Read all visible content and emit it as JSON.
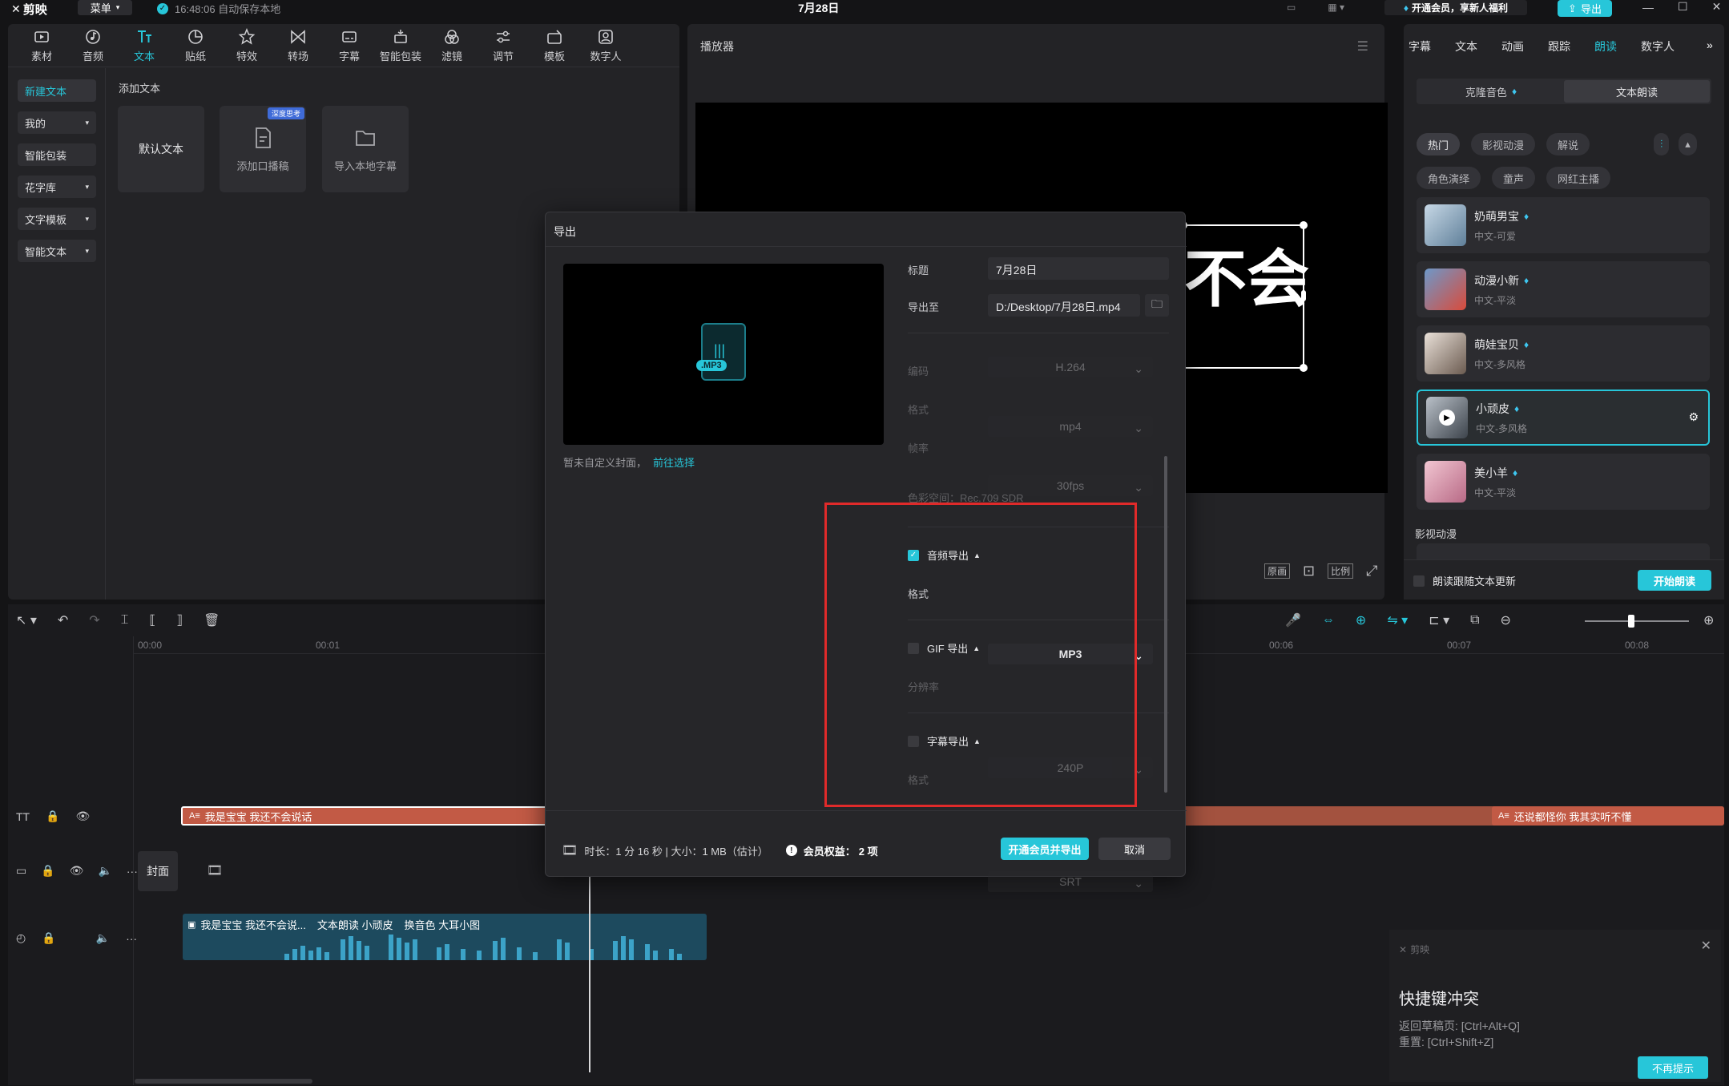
{
  "app": {
    "logo": "剪映",
    "menu_label": "菜单",
    "save_status": "16:48:06 自动保存本地",
    "project_title": "7月28日",
    "vip_promo": "开通会员，享新人福利",
    "export_label": "导出"
  },
  "toolbar": {
    "items": [
      {
        "label": "素材"
      },
      {
        "label": "音频"
      },
      {
        "label": "文本"
      },
      {
        "label": "贴纸"
      },
      {
        "label": "特效"
      },
      {
        "label": "转场"
      },
      {
        "label": "字幕"
      },
      {
        "label": "智能包装"
      },
      {
        "label": "滤镜"
      },
      {
        "label": "调节"
      },
      {
        "label": "模板"
      },
      {
        "label": "数字人"
      }
    ]
  },
  "sidebar": {
    "items": [
      {
        "label": "新建文本"
      },
      {
        "label": "我的"
      },
      {
        "label": "智能包装"
      },
      {
        "label": "花字库"
      },
      {
        "label": "文字模板"
      },
      {
        "label": "智能文本"
      }
    ]
  },
  "text_panel": {
    "heading": "添加文本",
    "cards": [
      {
        "label": "默认文本"
      },
      {
        "label": "添加口播稿",
        "badge": "深度思考"
      },
      {
        "label": "导入本地字幕"
      }
    ]
  },
  "player": {
    "title": "播放器",
    "preview_text": "不会",
    "controls": [
      "原画",
      "比例"
    ]
  },
  "right_panel": {
    "tabs": [
      {
        "label": "字幕"
      },
      {
        "label": "文本"
      },
      {
        "label": "动画"
      },
      {
        "label": "跟踪"
      },
      {
        "label": "朗读"
      },
      {
        "label": "数字人"
      }
    ],
    "sub_tabs": [
      {
        "label": "克隆音色"
      },
      {
        "label": "文本朗读"
      }
    ],
    "filters": [
      {
        "label": "热门"
      },
      {
        "label": "影视动漫"
      },
      {
        "label": "解说"
      },
      {
        "label": "角色演绎"
      },
      {
        "label": "童声"
      },
      {
        "label": "网红主播"
      }
    ],
    "voices": [
      {
        "name": "奶萌男宝",
        "desc": "中文-可爱"
      },
      {
        "name": "动漫小新",
        "desc": "中文-平淡"
      },
      {
        "name": "萌娃宝贝",
        "desc": "中文-多风格"
      },
      {
        "name": "小顽皮",
        "desc": "中文-多风格"
      },
      {
        "name": "美小羊",
        "desc": "中文-平淡"
      }
    ],
    "section_label": "影视动漫",
    "follow_label": "朗读跟随文本更新",
    "start_button": "开始朗读"
  },
  "export_dialog": {
    "title": "导出",
    "cover_note": "暂未自定义封面，",
    "cover_link": "前往选择",
    "file_badge": ".MP3",
    "title_label": "标题",
    "title_value": "7月28日",
    "path_label": "导出至",
    "path_value": "D:/Desktop/7月28日.mp4",
    "codec_label": "编码",
    "codec_value": "H.264",
    "format_label": "格式",
    "format_value": "mp4",
    "fps_label": "帧率",
    "fps_value": "30fps",
    "colorspace_text": "色彩空间：Rec.709 SDR",
    "audio_export_label": "音频导出",
    "audio_format_label": "格式",
    "audio_format_value": "MP3",
    "gif_export_label": "GIF 导出",
    "gif_res_label": "分辨率",
    "gif_res_value": "240P",
    "subtitle_export_label": "字幕导出",
    "subtitle_format_label": "格式",
    "subtitle_format_value": "SRT",
    "footer_info": "时长：1 分 16 秒 | 大小：1 MB（估计）",
    "member_label": "会员权益：",
    "member_count": "2 项",
    "vip_export_button": "开通会员并导出",
    "cancel_button": "取消"
  },
  "timeline": {
    "ticks": [
      "00:00",
      "00:01",
      "00:06",
      "00:07",
      "00:08"
    ],
    "text_clip_1": "我是宝宝 我还不会说话",
    "text_clip_2": "还说都怪你 我其实听不懂",
    "cover_label": "封面",
    "audio_clip_parts": [
      "我是宝宝 我还不会说...",
      "文本朗读 小顽皮",
      "换音色 大耳小图"
    ]
  },
  "notification": {
    "brand": "剪映",
    "title": "快捷键冲突",
    "line1": "返回草稿页: [Ctrl+Alt+Q]",
    "line2": "重置: [Ctrl+Shift+Z]",
    "dismiss_button": "不再提示"
  },
  "colors": {
    "accent": "#27c6d9",
    "highlight_box": "#e02a2a",
    "text_clip": "#c25a45",
    "audio_clip": "#1d4a5e"
  }
}
